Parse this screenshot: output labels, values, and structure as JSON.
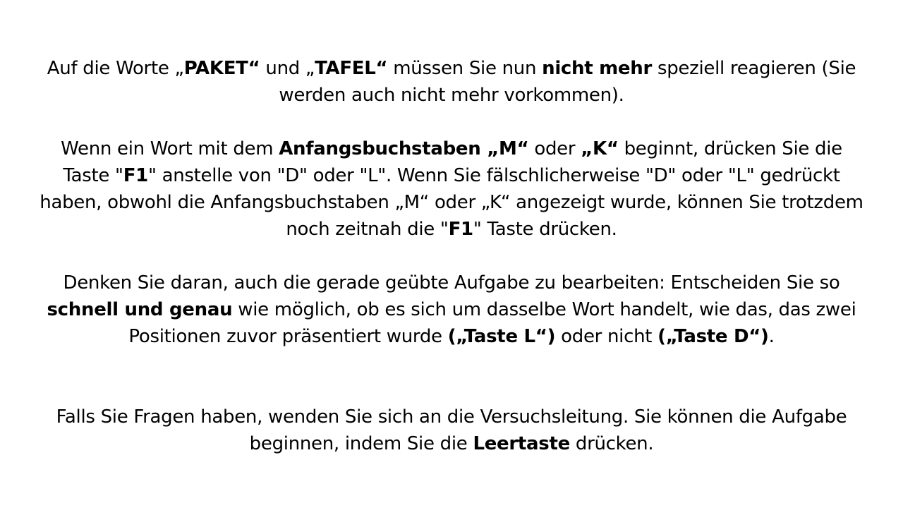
{
  "instructions": {
    "p1": {
      "t1": "Auf die Worte „",
      "b1": "PAKET“",
      "t2": " und „",
      "b2": "TAFEL“",
      "t3": " müssen Sie nun ",
      "b3": "nicht mehr",
      "t4": " speziell reagieren (Sie werden auch nicht mehr vorkommen)."
    },
    "p2": {
      "t1": "Wenn ein Wort mit dem ",
      "b1": "Anfangsbuchstaben „M“",
      "t2": "  oder ",
      "b2": "„K“",
      "t3": " beginnt, drücken Sie die Taste \"",
      "b3": "F1",
      "t4": "\" anstelle von \"D\" oder \"L\". Wenn Sie fälschlicherweise \"D\" oder \"L\" gedrückt haben, obwohl die Anfangsbuchstaben „M“ oder „K“ angezeigt wurde, können Sie trotzdem noch zeitnah die \"",
      "b4": "F1",
      "t5": "\" Taste drücken."
    },
    "p3": {
      "t1": "Denken Sie daran, auch die gerade geübte Aufgabe zu bearbeiten: Entscheiden Sie so ",
      "b1": "schnell und genau",
      "t2": " wie möglich, ob es sich um dasselbe Wort handelt, wie das, das zwei Positionen zuvor präsentiert wurde ",
      "b2": "(„Taste L“)",
      "t3": " oder nicht ",
      "b3": "(„Taste D“)",
      "t4": "."
    },
    "p4": {
      "t1": "Falls Sie Fragen haben, wenden Sie sich an die Versuchsleitung. Sie können die Aufgabe beginnen, indem Sie die ",
      "b1": "Leertaste",
      "t2": " drücken."
    }
  }
}
